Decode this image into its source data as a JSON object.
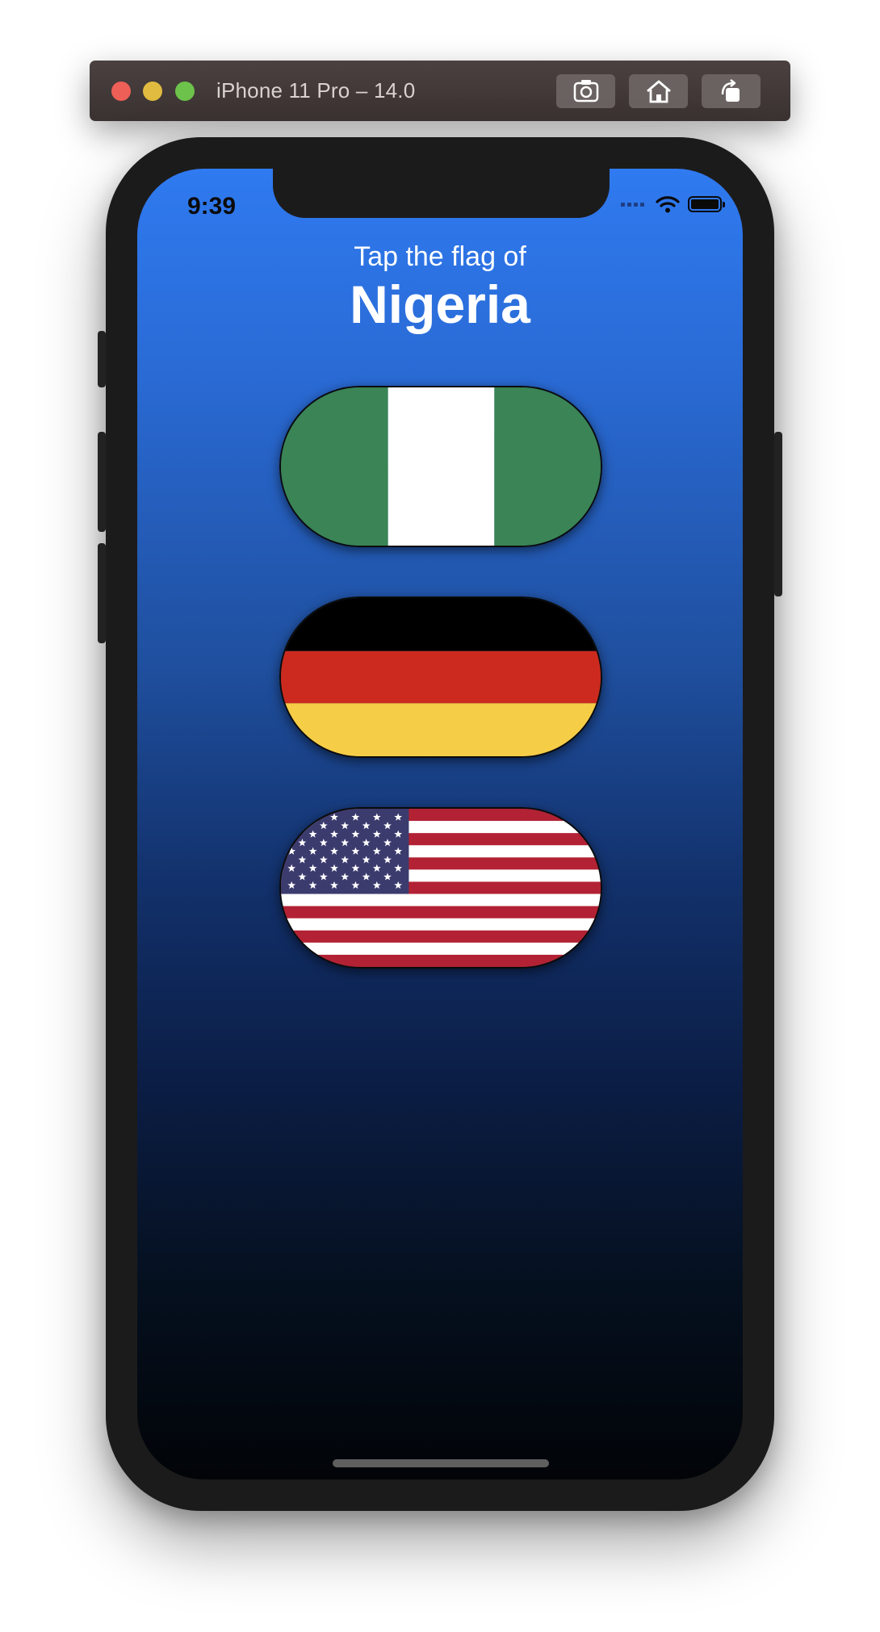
{
  "simulator": {
    "title": "iPhone 11 Pro – 14.0",
    "buttons": [
      {
        "name": "screenshot",
        "icon": "camera-icon"
      },
      {
        "name": "home",
        "icon": "home-icon"
      },
      {
        "name": "rotate",
        "icon": "rotate-icon"
      }
    ]
  },
  "status_bar": {
    "time": "9:39"
  },
  "game": {
    "prompt": "Tap the flag of",
    "country": "Nigeria",
    "flags": [
      {
        "country": "Nigeria",
        "stripes": "vertical",
        "colors": [
          "#3a8455",
          "#ffffff",
          "#3a8455"
        ]
      },
      {
        "country": "Germany",
        "stripes": "horizontal",
        "colors": [
          "#000000",
          "#cc2a1e",
          "#f6cd46"
        ]
      },
      {
        "country": "US",
        "stripes": "us",
        "colors": [
          "#b22234",
          "#ffffff",
          "#3c3b6e"
        ]
      }
    ]
  },
  "colors": {
    "background_top": "#2f7af0",
    "background_bottom": "#020408"
  }
}
